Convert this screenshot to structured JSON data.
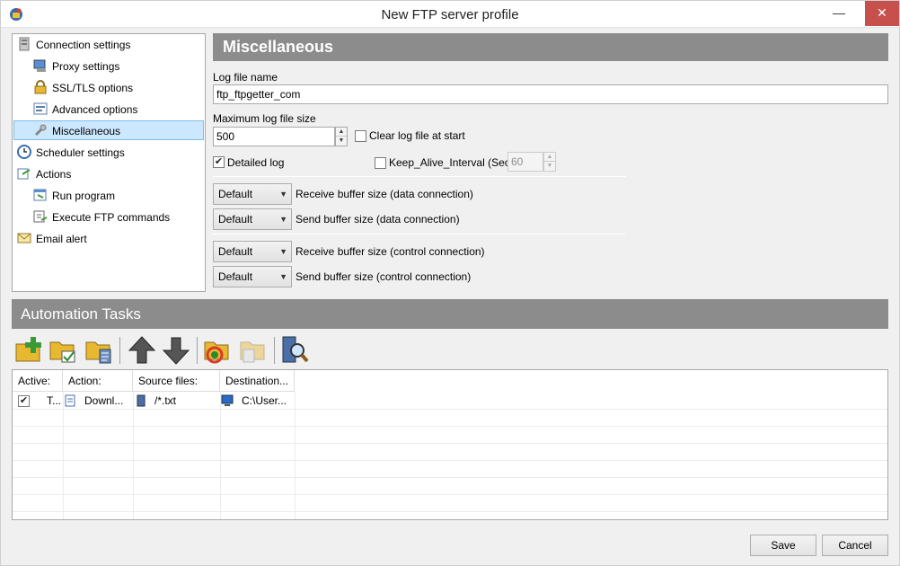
{
  "window": {
    "title": "New FTP server profile"
  },
  "tree": {
    "items": [
      {
        "label": "Connection settings"
      },
      {
        "label": "Proxy settings"
      },
      {
        "label": "SSL/TLS options"
      },
      {
        "label": "Advanced options"
      },
      {
        "label": "Miscellaneous"
      },
      {
        "label": "Scheduler settings"
      },
      {
        "label": "Actions"
      },
      {
        "label": "Run program"
      },
      {
        "label": "Execute FTP commands"
      },
      {
        "label": "Email alert"
      }
    ]
  },
  "misc": {
    "title": "Miscellaneous",
    "log_file_label": "Log file name",
    "log_file_value": "ftp_ftpgetter_com",
    "max_size_label": "Maximum log file size",
    "max_size_value": "500",
    "clear_log_label": "Clear log file at start",
    "clear_log_checked": false,
    "detailed_log_label": "Detailed log",
    "detailed_log_checked": true,
    "keepalive_label": "Keep_Alive_Interval (Sec)",
    "keepalive_checked": false,
    "keepalive_value": "60",
    "buffers": [
      {
        "value": "Default",
        "label": "Receive buffer size (data connection)"
      },
      {
        "value": "Default",
        "label": "Send buffer size (data connection)"
      },
      {
        "value": "Default",
        "label": "Receive buffer size (control connection)"
      },
      {
        "value": "Default",
        "label": "Send buffer size (control connection)"
      }
    ]
  },
  "automation": {
    "title": "Automation Tasks",
    "columns": [
      "Active:",
      "Action:",
      "Source files:",
      "Destination..."
    ],
    "rows": [
      {
        "active": true,
        "type": "T...",
        "action": "Downl...",
        "source": "/*.txt",
        "destination": "C:\\User..."
      }
    ]
  },
  "buttons": {
    "save": "Save",
    "cancel": "Cancel"
  },
  "colors": {
    "header_bg": "#8c8c8c",
    "selection_bg": "#cce8ff",
    "close_btn": "#c7504c"
  }
}
